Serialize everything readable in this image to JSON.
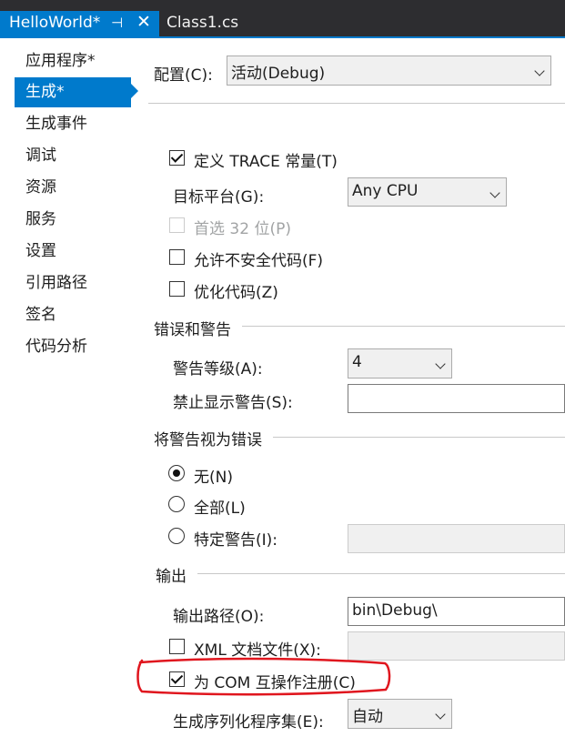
{
  "tabs": {
    "active": {
      "label": "HelloWorld*",
      "pin_glyph": "⊣",
      "close_glyph": "✕"
    },
    "inactive": {
      "label": "Class1.cs"
    }
  },
  "sidebar": {
    "items": [
      {
        "label": "应用程序*"
      },
      {
        "label": "生成*",
        "active": true
      },
      {
        "label": "生成事件"
      },
      {
        "label": "调试"
      },
      {
        "label": "资源"
      },
      {
        "label": "服务"
      },
      {
        "label": "设置"
      },
      {
        "label": "引用路径"
      },
      {
        "label": "签名"
      },
      {
        "label": "代码分析"
      }
    ]
  },
  "config": {
    "label": "配置(C):",
    "value": "活动(Debug)"
  },
  "general": {
    "define_trace": {
      "label": "定义 TRACE 常量(T)",
      "checked": true
    },
    "platform_target": {
      "label": "目标平台(G):",
      "value": "Any CPU"
    },
    "prefer_32bit": {
      "label": "首选 32 位(P)",
      "checked": false,
      "disabled": true
    },
    "allow_unsafe": {
      "label": "允许不安全代码(F)",
      "checked": false
    },
    "optimize": {
      "label": "优化代码(Z)",
      "checked": false
    }
  },
  "errors_warnings": {
    "title": "错误和警告",
    "warning_level": {
      "label": "警告等级(A):",
      "value": "4"
    },
    "suppress": {
      "label": "禁止显示警告(S):",
      "value": ""
    }
  },
  "treat_warnings": {
    "title": "将警告视为错误",
    "none": {
      "label": "无(N)",
      "selected": true
    },
    "all": {
      "label": "全部(L)",
      "selected": false
    },
    "specific": {
      "label": "特定警告(I):",
      "selected": false,
      "value": ""
    }
  },
  "output": {
    "title": "输出",
    "path": {
      "label": "输出路径(O):",
      "value": "bin\\Debug\\"
    },
    "xml_doc": {
      "label": "XML 文档文件(X):",
      "checked": false,
      "value": ""
    },
    "com_interop": {
      "label": "为 COM 互操作注册(C)",
      "checked": true
    },
    "serialization": {
      "label": "生成序列化程序集(E):",
      "value": "自动"
    }
  },
  "colors": {
    "accent": "#007acc",
    "tabstrip": "#2d2d30",
    "annotation": "#e0161e"
  }
}
